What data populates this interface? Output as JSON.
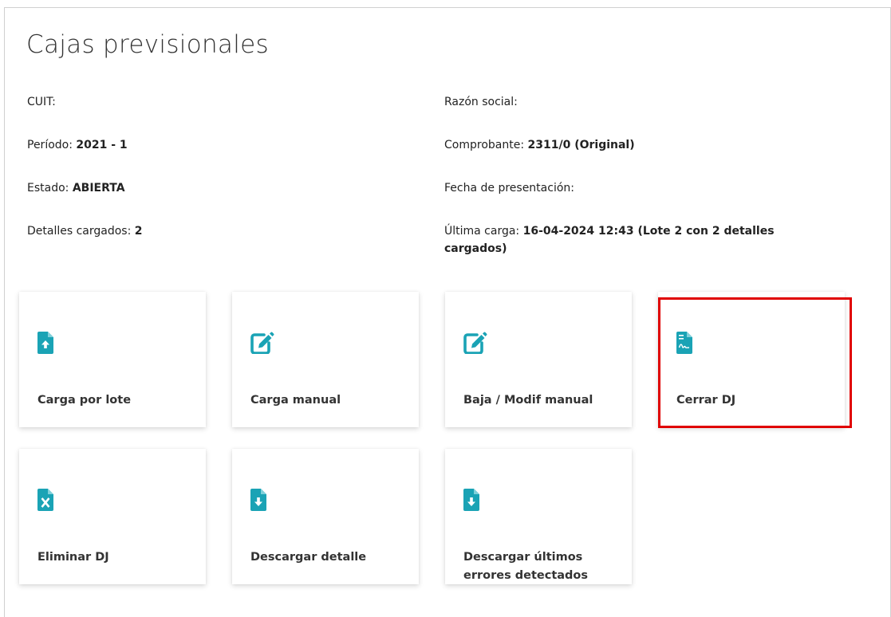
{
  "page": {
    "title": "Cajas previsionales"
  },
  "info": {
    "cuit_label": "CUIT:",
    "razon_label": "Razón social:",
    "periodo_label": "Período: ",
    "periodo_value": "2021 - 1",
    "comprobante_label": "Comprobante: ",
    "comprobante_value": "2311/0 (Original)",
    "estado_label": "Estado: ",
    "estado_value": "ABIERTA",
    "fecha_label": "Fecha de presentación:",
    "detalles_label": "Detalles cargados: ",
    "detalles_value": "2",
    "ultima_label": "Última carga: ",
    "ultima_value_line1": "16-04-2024 12:43 (Lote 2 con 2 detalles",
    "ultima_value_line2": "cargados)"
  },
  "cards": [
    {
      "label": "Carga por lote",
      "icon": "file-upload-icon"
    },
    {
      "label": "Carga manual",
      "icon": "edit-icon"
    },
    {
      "label": "Baja / Modif manual",
      "icon": "edit-icon"
    },
    {
      "label": "Cerrar DJ",
      "icon": "file-signature-icon"
    },
    {
      "label": "Eliminar DJ",
      "icon": "file-excel-icon"
    },
    {
      "label": "Descargar detalle",
      "icon": "file-download-icon"
    },
    {
      "label_line1": "Descargar últimos",
      "label_line2": "errores detectados",
      "icon": "file-download-icon"
    }
  ],
  "colors": {
    "icon": "#1aa3b5",
    "highlight": "#e00000"
  }
}
